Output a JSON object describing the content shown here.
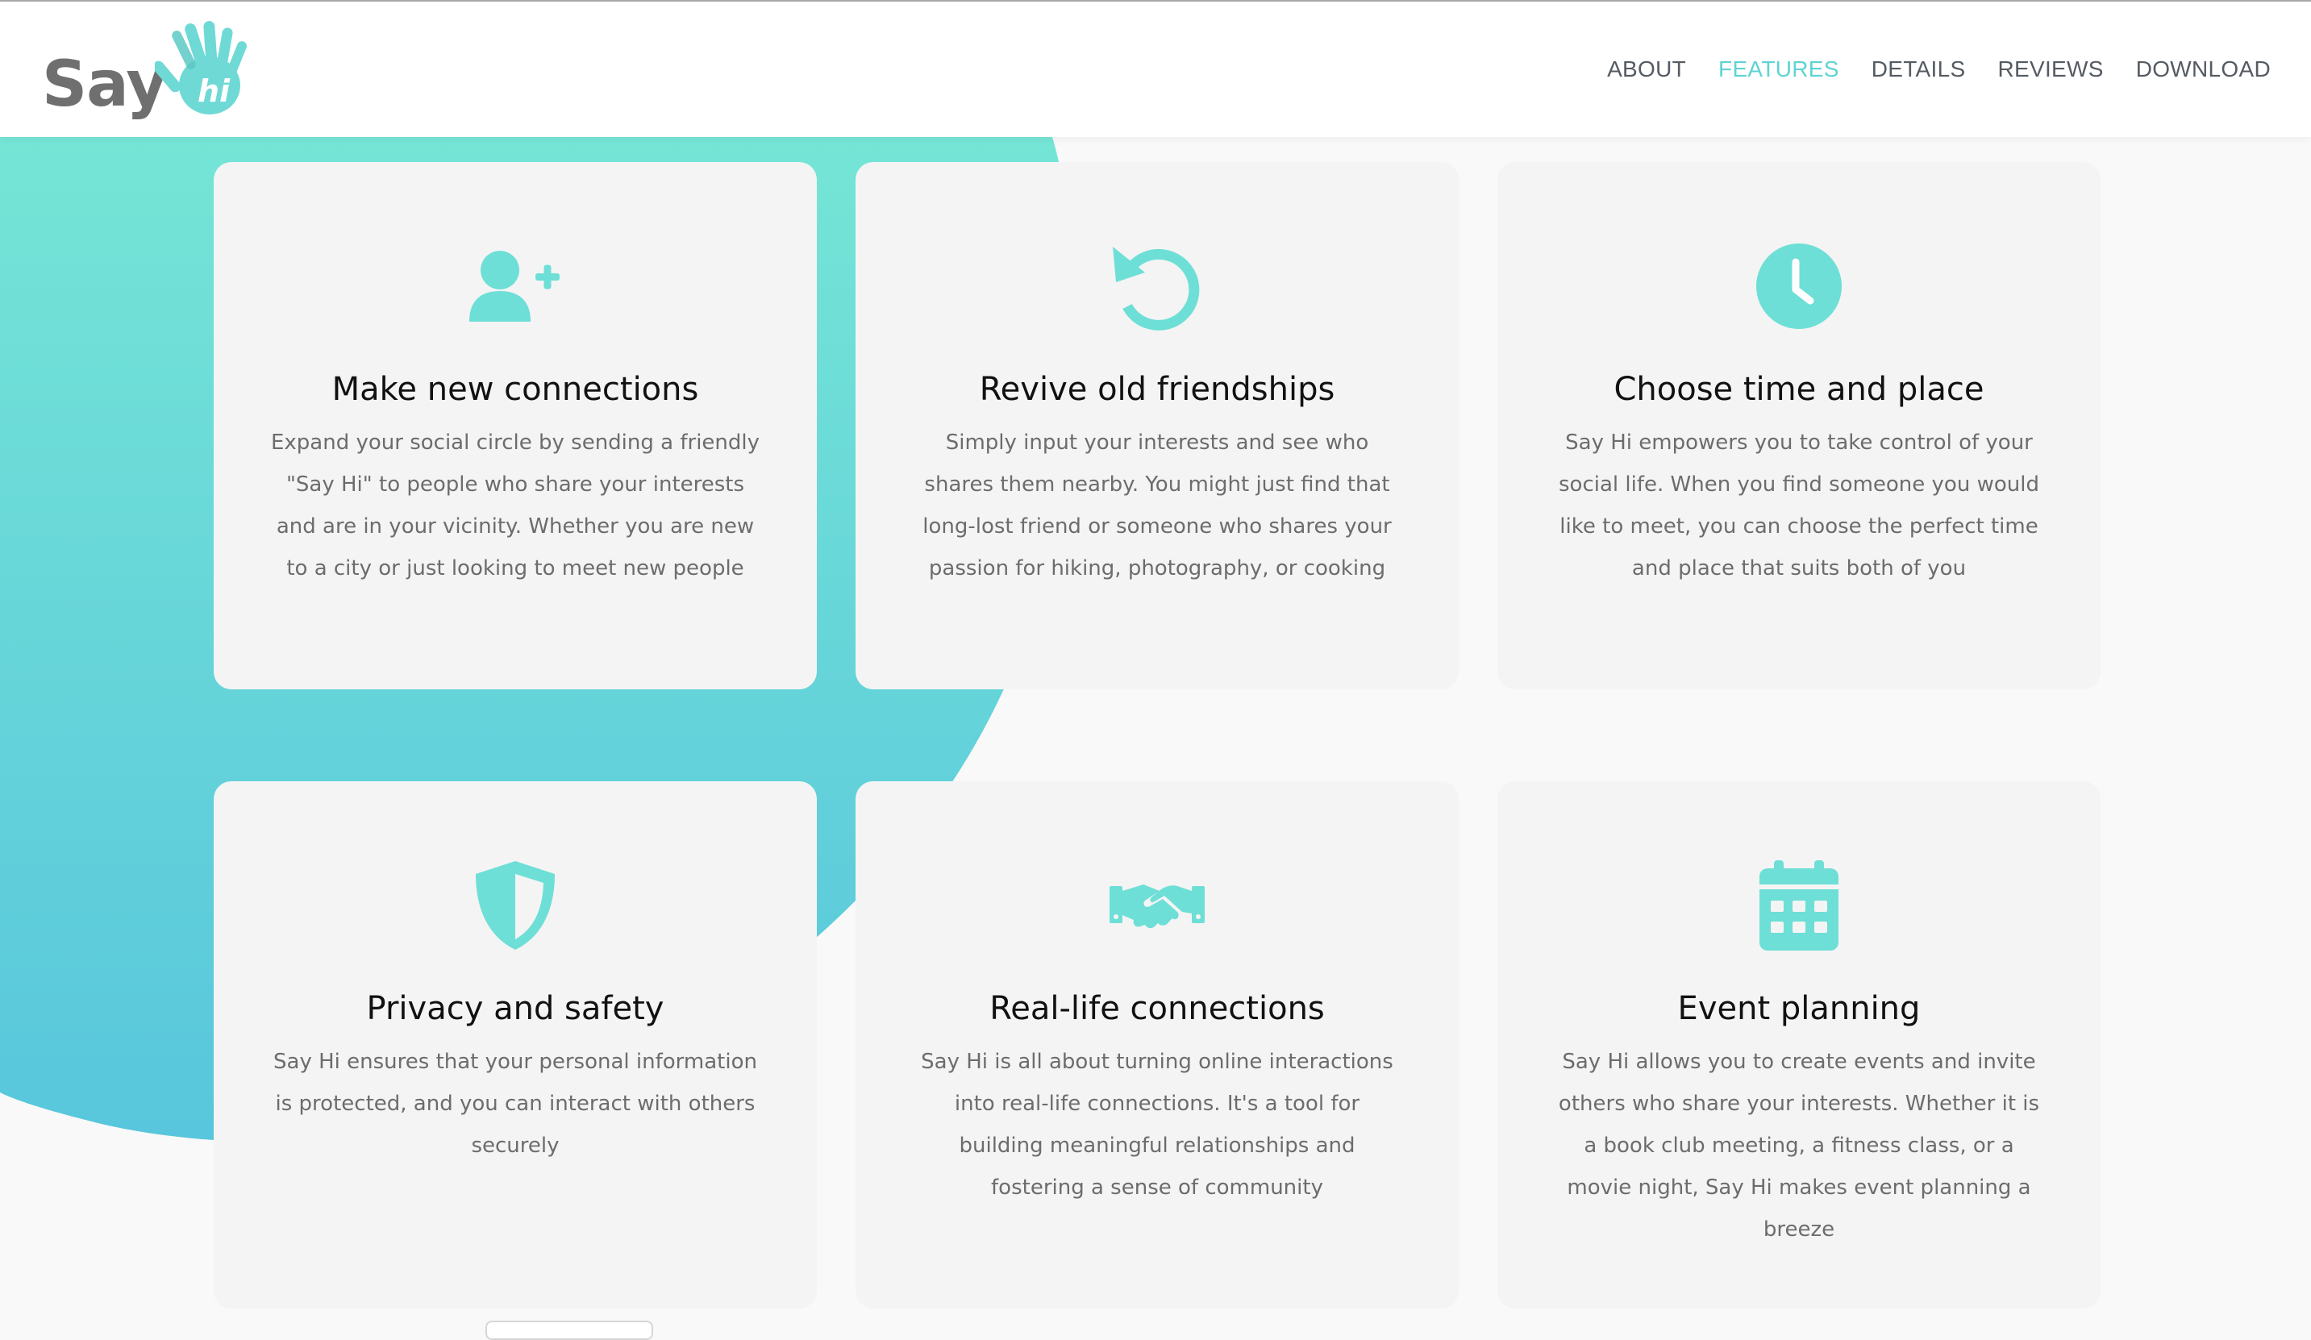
{
  "brand": {
    "logo_text": "Say",
    "logo_accent_text": "hi"
  },
  "nav": {
    "items": [
      {
        "label": "ABOUT",
        "active": false
      },
      {
        "label": "FEATURES",
        "active": true
      },
      {
        "label": "DETAILS",
        "active": false
      },
      {
        "label": "REVIEWS",
        "active": false
      },
      {
        "label": "DOWNLOAD",
        "active": false
      }
    ]
  },
  "features": [
    {
      "icon": "user-plus-icon",
      "title": "Make new connections",
      "description": "Expand your social circle by sending a friendly \"Say Hi\" to people who share your interests and are in your vicinity. Whether you are new to a city or just looking to meet new people"
    },
    {
      "icon": "rotate-left-icon",
      "title": "Revive old friendships",
      "description": "Simply input your interests and see who shares them nearby. You might just find that long-lost friend or someone who shares your passion for hiking, photography, or cooking"
    },
    {
      "icon": "clock-icon",
      "title": "Choose time and place",
      "description": "Say Hi empowers you to take control of your social life. When you find someone you would like to meet, you can choose the perfect time and place that suits both of you"
    },
    {
      "icon": "shield-icon",
      "title": "Privacy and safety",
      "description": "Say Hi ensures that your personal information is protected, and you can interact with others securely"
    },
    {
      "icon": "handshake-icon",
      "title": "Real-life connections",
      "description": "Say Hi is all about turning online interactions into real-life connections. It's a tool for building meaningful relationships and fostering a sense of community"
    },
    {
      "icon": "calendar-icon",
      "title": "Event planning",
      "description": "Say Hi allows you to create events and invite others who share your interests. Whether it is a book club meeting, a fitness class, or a movie night, Say Hi makes event planning a breeze"
    }
  ],
  "colors": {
    "accent": "#5fd3d3",
    "gradient_top": "#74e4d6",
    "gradient_bottom": "#5ac8dc",
    "logo_gray": "#6f6f6f",
    "nav_text": "#555b62",
    "card_bg": "#f4f4f4",
    "title_text": "#111111",
    "body_text": "#6c6c6c"
  }
}
